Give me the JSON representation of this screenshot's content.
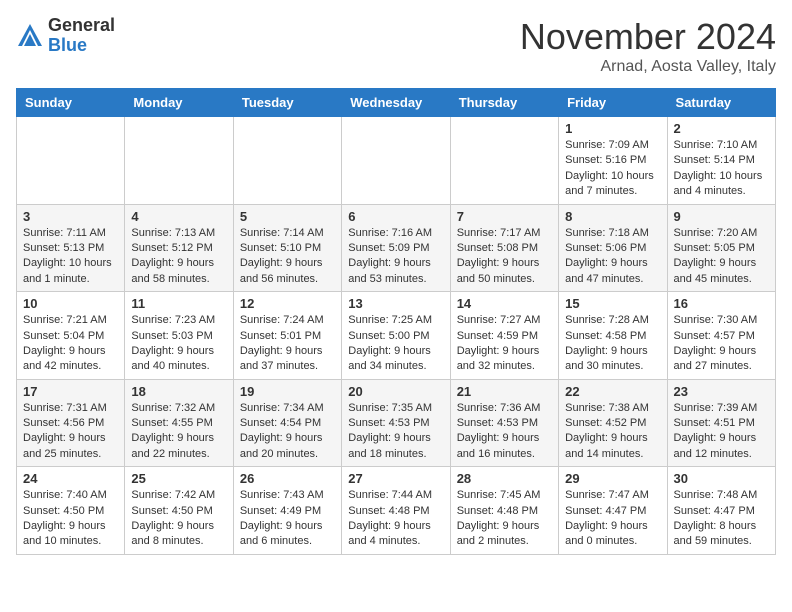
{
  "logo": {
    "general": "General",
    "blue": "Blue"
  },
  "header": {
    "month": "November 2024",
    "location": "Arnad, Aosta Valley, Italy"
  },
  "weekdays": [
    "Sunday",
    "Monday",
    "Tuesday",
    "Wednesday",
    "Thursday",
    "Friday",
    "Saturday"
  ],
  "weeks": [
    [
      {
        "day": "",
        "info": ""
      },
      {
        "day": "",
        "info": ""
      },
      {
        "day": "",
        "info": ""
      },
      {
        "day": "",
        "info": ""
      },
      {
        "day": "",
        "info": ""
      },
      {
        "day": "1",
        "info": "Sunrise: 7:09 AM\nSunset: 5:16 PM\nDaylight: 10 hours and 7 minutes."
      },
      {
        "day": "2",
        "info": "Sunrise: 7:10 AM\nSunset: 5:14 PM\nDaylight: 10 hours and 4 minutes."
      }
    ],
    [
      {
        "day": "3",
        "info": "Sunrise: 7:11 AM\nSunset: 5:13 PM\nDaylight: 10 hours and 1 minute."
      },
      {
        "day": "4",
        "info": "Sunrise: 7:13 AM\nSunset: 5:12 PM\nDaylight: 9 hours and 58 minutes."
      },
      {
        "day": "5",
        "info": "Sunrise: 7:14 AM\nSunset: 5:10 PM\nDaylight: 9 hours and 56 minutes."
      },
      {
        "day": "6",
        "info": "Sunrise: 7:16 AM\nSunset: 5:09 PM\nDaylight: 9 hours and 53 minutes."
      },
      {
        "day": "7",
        "info": "Sunrise: 7:17 AM\nSunset: 5:08 PM\nDaylight: 9 hours and 50 minutes."
      },
      {
        "day": "8",
        "info": "Sunrise: 7:18 AM\nSunset: 5:06 PM\nDaylight: 9 hours and 47 minutes."
      },
      {
        "day": "9",
        "info": "Sunrise: 7:20 AM\nSunset: 5:05 PM\nDaylight: 9 hours and 45 minutes."
      }
    ],
    [
      {
        "day": "10",
        "info": "Sunrise: 7:21 AM\nSunset: 5:04 PM\nDaylight: 9 hours and 42 minutes."
      },
      {
        "day": "11",
        "info": "Sunrise: 7:23 AM\nSunset: 5:03 PM\nDaylight: 9 hours and 40 minutes."
      },
      {
        "day": "12",
        "info": "Sunrise: 7:24 AM\nSunset: 5:01 PM\nDaylight: 9 hours and 37 minutes."
      },
      {
        "day": "13",
        "info": "Sunrise: 7:25 AM\nSunset: 5:00 PM\nDaylight: 9 hours and 34 minutes."
      },
      {
        "day": "14",
        "info": "Sunrise: 7:27 AM\nSunset: 4:59 PM\nDaylight: 9 hours and 32 minutes."
      },
      {
        "day": "15",
        "info": "Sunrise: 7:28 AM\nSunset: 4:58 PM\nDaylight: 9 hours and 30 minutes."
      },
      {
        "day": "16",
        "info": "Sunrise: 7:30 AM\nSunset: 4:57 PM\nDaylight: 9 hours and 27 minutes."
      }
    ],
    [
      {
        "day": "17",
        "info": "Sunrise: 7:31 AM\nSunset: 4:56 PM\nDaylight: 9 hours and 25 minutes."
      },
      {
        "day": "18",
        "info": "Sunrise: 7:32 AM\nSunset: 4:55 PM\nDaylight: 9 hours and 22 minutes."
      },
      {
        "day": "19",
        "info": "Sunrise: 7:34 AM\nSunset: 4:54 PM\nDaylight: 9 hours and 20 minutes."
      },
      {
        "day": "20",
        "info": "Sunrise: 7:35 AM\nSunset: 4:53 PM\nDaylight: 9 hours and 18 minutes."
      },
      {
        "day": "21",
        "info": "Sunrise: 7:36 AM\nSunset: 4:53 PM\nDaylight: 9 hours and 16 minutes."
      },
      {
        "day": "22",
        "info": "Sunrise: 7:38 AM\nSunset: 4:52 PM\nDaylight: 9 hours and 14 minutes."
      },
      {
        "day": "23",
        "info": "Sunrise: 7:39 AM\nSunset: 4:51 PM\nDaylight: 9 hours and 12 minutes."
      }
    ],
    [
      {
        "day": "24",
        "info": "Sunrise: 7:40 AM\nSunset: 4:50 PM\nDaylight: 9 hours and 10 minutes."
      },
      {
        "day": "25",
        "info": "Sunrise: 7:42 AM\nSunset: 4:50 PM\nDaylight: 9 hours and 8 minutes."
      },
      {
        "day": "26",
        "info": "Sunrise: 7:43 AM\nSunset: 4:49 PM\nDaylight: 9 hours and 6 minutes."
      },
      {
        "day": "27",
        "info": "Sunrise: 7:44 AM\nSunset: 4:48 PM\nDaylight: 9 hours and 4 minutes."
      },
      {
        "day": "28",
        "info": "Sunrise: 7:45 AM\nSunset: 4:48 PM\nDaylight: 9 hours and 2 minutes."
      },
      {
        "day": "29",
        "info": "Sunrise: 7:47 AM\nSunset: 4:47 PM\nDaylight: 9 hours and 0 minutes."
      },
      {
        "day": "30",
        "info": "Sunrise: 7:48 AM\nSunset: 4:47 PM\nDaylight: 8 hours and 59 minutes."
      }
    ]
  ]
}
